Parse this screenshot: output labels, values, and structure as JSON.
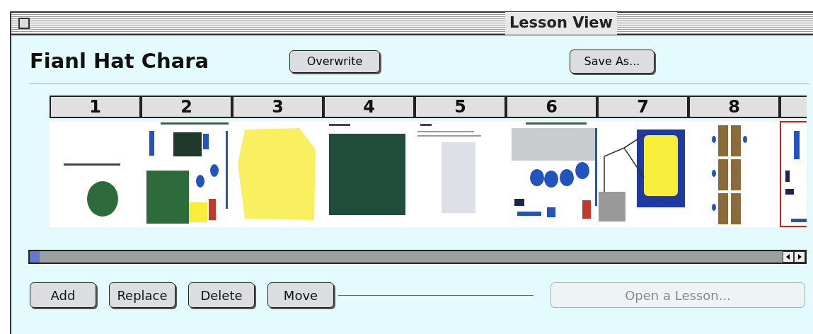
{
  "window": {
    "title": "Lesson View"
  },
  "lesson": {
    "title": "Fianl Hat Chara"
  },
  "top_buttons": [
    {
      "label": "Overwrite"
    },
    {
      "label": "Save As..."
    }
  ],
  "slides": [
    {
      "number": "1",
      "selected": false
    },
    {
      "number": "2",
      "selected": false
    },
    {
      "number": "3",
      "selected": false
    },
    {
      "number": "4",
      "selected": false
    },
    {
      "number": "5",
      "selected": false
    },
    {
      "number": "6",
      "selected": false
    },
    {
      "number": "7",
      "selected": false
    },
    {
      "number": "8",
      "selected": false
    },
    {
      "selected": true
    }
  ],
  "bottom_buttons": [
    {
      "label": "Add",
      "disabled": false
    },
    {
      "label": "Replace",
      "disabled": false
    },
    {
      "label": "Delete",
      "disabled": false
    },
    {
      "label": "Move",
      "disabled": false
    },
    {
      "label": "Open a Lesson...",
      "disabled": true
    }
  ]
}
